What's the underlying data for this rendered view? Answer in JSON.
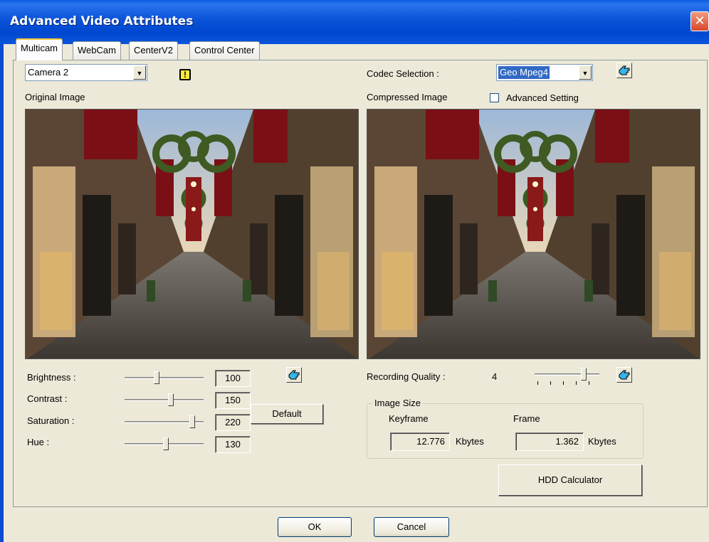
{
  "window": {
    "title": "Advanced Video Attributes",
    "close_glyph": "✕"
  },
  "tabs": [
    {
      "label": "Multicam",
      "active": true
    },
    {
      "label": "WebCam",
      "active": false
    },
    {
      "label": "CenterV2",
      "active": false
    },
    {
      "label": "Control Center",
      "active": false
    }
  ],
  "camera": {
    "selected": "Camera 2",
    "warning_glyph": "!"
  },
  "original": {
    "label": "Original Image"
  },
  "codec": {
    "label": "Codec Selection :",
    "selected": "Geo Mpeg4"
  },
  "compressed": {
    "label": "Compressed Image",
    "advanced_label": "Advanced Setting",
    "advanced_checked": false
  },
  "adjustments": {
    "brightness": {
      "label": "Brightness :",
      "value": "100"
    },
    "contrast": {
      "label": "Contrast :",
      "value": "150"
    },
    "saturation": {
      "label": "Saturation :",
      "value": "220"
    },
    "hue": {
      "label": "Hue :",
      "value": "130"
    },
    "default_label": "Default"
  },
  "recording": {
    "label": "Recording Quality :",
    "value": "4"
  },
  "image_size": {
    "title": "Image Size",
    "keyframe_label": "Keyframe",
    "frame_label": "Frame",
    "keyframe_value": "12.776",
    "frame_value": "1.362",
    "unit": "Kbytes"
  },
  "hdd_label": "HDD Calculator",
  "footer": {
    "ok": "OK",
    "cancel": "Cancel"
  },
  "colors": {
    "title_bar": "#0a52d8",
    "dialog_bg": "#ece9d8",
    "selection": "#316ac5",
    "warning": "#ffeb3b"
  }
}
